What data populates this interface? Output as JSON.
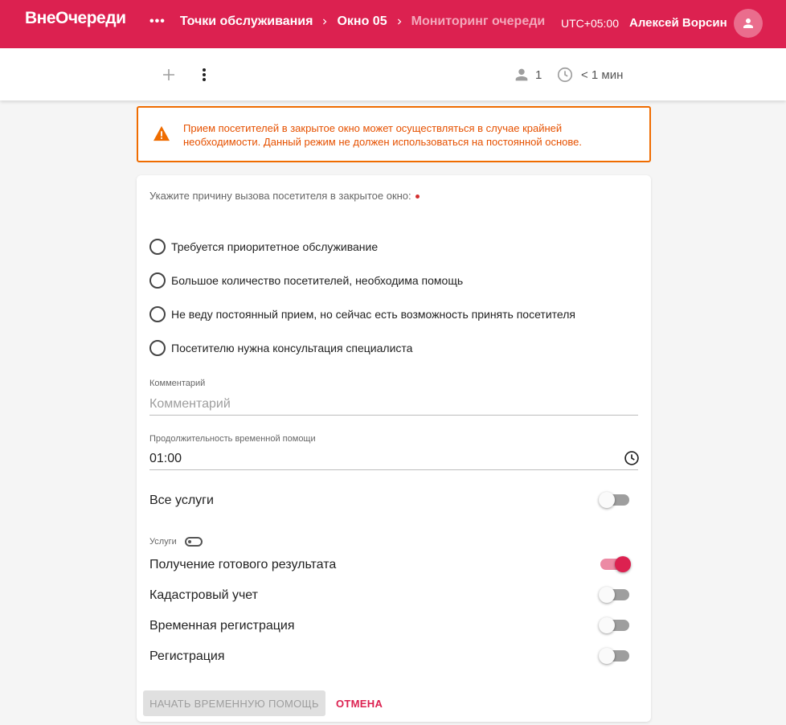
{
  "app": {
    "brand": "ВнеОчереди"
  },
  "breadcrumb": {
    "more": "•••",
    "items": [
      "Точки обслуживания",
      "Окно 05"
    ],
    "current": "Мониторинг очереди"
  },
  "header": {
    "timezone": "UTC+05:00",
    "user_name": "Алексей Ворсин"
  },
  "toolbar": {
    "queue_count": "1",
    "wait_time": "< 1 мин"
  },
  "warning": {
    "text": "Прием посетителей в закрытое окно может осуществляться в случае крайней необходимости. Данный режим не должен использоваться на постоянной основе."
  },
  "form": {
    "question": "Укажите причину вызова посетителя в закрытое окно:",
    "reasons": [
      "Требуется приоритетное обслуживание",
      "Большое количество посетителей, необходима помощь",
      "Не веду постоянный прием, но сейчас есть возможность принять посетителя",
      "Посетителю нужна консультация специалиста"
    ],
    "comment_label": "Комментарий",
    "comment_placeholder": "Комментарий",
    "comment_value": "",
    "duration_label": "Продолжительность временной помощи",
    "duration_value": "01:00",
    "all_services_label": "Все услуги",
    "all_services_on": false,
    "services_label": "Услуги",
    "services": [
      {
        "label": "Получение готового результата",
        "on": true
      },
      {
        "label": "Кадастровый учет",
        "on": false
      },
      {
        "label": "Временная регистрация",
        "on": false
      },
      {
        "label": "Регистрация",
        "on": false
      }
    ],
    "start_button": "НАЧАТЬ ВРЕМЕННУЮ ПОМОЩЬ",
    "cancel_button": "ОТМЕНА"
  },
  "colors": {
    "brand": "#dc2150",
    "warning": "#ef6c00",
    "toggle_off": "#9e9e9e"
  },
  "icons": [
    "more-horiz-icon",
    "chevron-right-icon",
    "account-icon",
    "plus-icon",
    "more-vert-icon",
    "person-icon",
    "clock-icon",
    "warning-icon",
    "time-icon",
    "toggle-icon"
  ]
}
